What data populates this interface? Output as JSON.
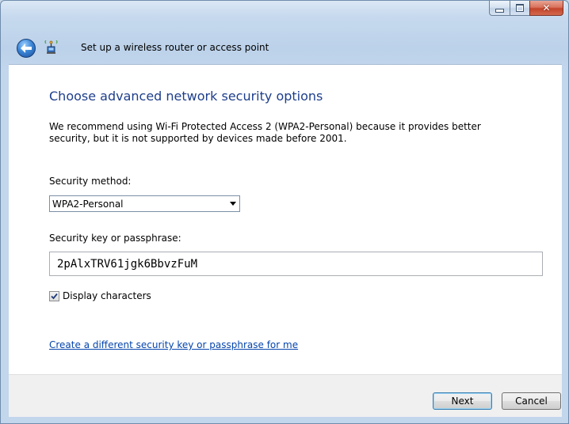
{
  "window": {
    "title": "Set up a wireless router or access point",
    "caption_buttons": {
      "minimize_icon": "minimize-icon",
      "maximize_icon": "maximize-icon",
      "close_icon": "close-icon"
    }
  },
  "content": {
    "heading": "Choose advanced network security options",
    "description": "We recommend using Wi-Fi Protected Access 2 (WPA2-Personal) because it provides better security,  but it is not supported by devices made before 2001.",
    "security_method_label": "Security method:",
    "security_method_value": "WPA2-Personal",
    "passphrase_label": "Security key or passphrase:",
    "passphrase_value": "2pAlxTRV61jgk6BbvzFuM",
    "display_characters_label": "Display characters",
    "display_characters_checked": true,
    "create_key_link": "Create a different security key or passphrase for me"
  },
  "footer": {
    "next_label": "Next",
    "cancel_label": "Cancel"
  },
  "colors": {
    "heading": "#1e3e8c",
    "link": "#0645ad",
    "close_button": "#c2442a"
  }
}
